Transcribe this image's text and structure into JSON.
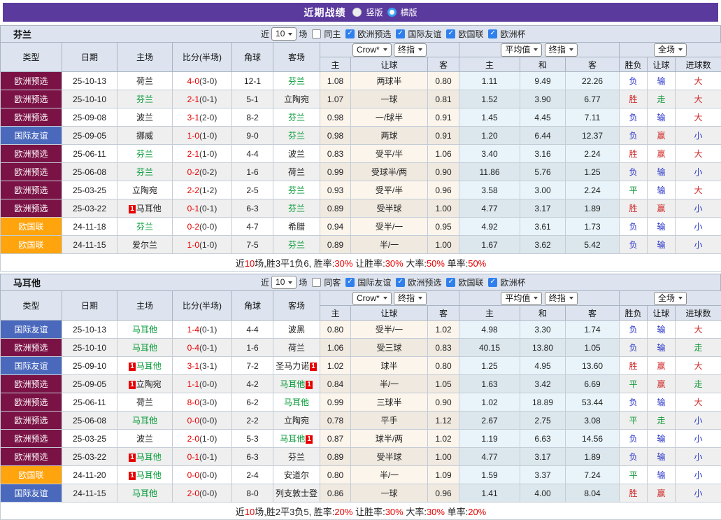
{
  "title_bar": {
    "title": "近期战绩",
    "vertical": "竖版",
    "horizontal": "横版"
  },
  "columns": [
    "类型",
    "日期",
    "主场",
    "比分(半场)",
    "角球",
    "客场"
  ],
  "sub_columns": [
    "主",
    "让球",
    "客",
    "主",
    "和",
    "客",
    "胜负",
    "让球",
    "进球数"
  ],
  "category_colors": {
    "欧洲预选": "#7a1245",
    "国际友谊": "#4a69bd",
    "欧国联": "#ffa40d",
    "欧洲杯": "#2e8b57"
  },
  "result_colors": {
    "r": "#cf2a2a",
    "g": "#189a3e",
    "b": "#2a35c8"
  },
  "tables": [
    {
      "team": "芬兰",
      "filters": {
        "near": "近",
        "count": "10",
        "games": "场",
        "same": "同主",
        "leagues": [
          "欧洲预选",
          "国际友谊",
          "欧国联",
          "欧洲杯"
        ]
      },
      "controls": {
        "company": "Crow*",
        "final1": "终指",
        "average": "平均值",
        "final2": "终指",
        "scope": "全场"
      },
      "rows": [
        {
          "type": "欧洲预选",
          "date": "25-10-13",
          "home": "荷兰",
          "home_self": false,
          "home_card": "",
          "score_full": "4-0",
          "score_half": "(3-0)",
          "corner": "12-1",
          "away": "芬兰",
          "away_self": true,
          "away_card": "",
          "crow_home": "1.08",
          "crow_hcp": "两球半",
          "crow_away": "0.80",
          "avg_home": "1.11",
          "avg_draw": "9.49",
          "avg_away": "22.26",
          "res_wdl": "负",
          "res_hcp": "输",
          "res_goal": "大"
        },
        {
          "type": "欧洲预选",
          "date": "25-10-10",
          "home": "芬兰",
          "home_self": true,
          "home_card": "",
          "score_full": "2-1",
          "score_half": "(0-1)",
          "corner": "5-1",
          "away": "立陶宛",
          "away_self": false,
          "away_card": "",
          "crow_home": "1.07",
          "crow_hcp": "一球",
          "crow_away": "0.81",
          "avg_home": "1.52",
          "avg_draw": "3.90",
          "avg_away": "6.77",
          "res_wdl": "胜",
          "res_hcp": "走",
          "res_goal": "大"
        },
        {
          "type": "欧洲预选",
          "date": "25-09-08",
          "home": "波兰",
          "home_self": false,
          "home_card": "",
          "score_full": "3-1",
          "score_half": "(2-0)",
          "corner": "8-2",
          "away": "芬兰",
          "away_self": true,
          "away_card": "",
          "crow_home": "0.98",
          "crow_hcp": "一/球半",
          "crow_away": "0.91",
          "avg_home": "1.45",
          "avg_draw": "4.45",
          "avg_away": "7.11",
          "res_wdl": "负",
          "res_hcp": "输",
          "res_goal": "大"
        },
        {
          "type": "国际友谊",
          "date": "25-09-05",
          "home": "挪威",
          "home_self": false,
          "home_card": "",
          "score_full": "1-0",
          "score_half": "(1-0)",
          "corner": "9-0",
          "away": "芬兰",
          "away_self": true,
          "away_card": "",
          "crow_home": "0.98",
          "crow_hcp": "两球",
          "crow_away": "0.91",
          "avg_home": "1.20",
          "avg_draw": "6.44",
          "avg_away": "12.37",
          "res_wdl": "负",
          "res_hcp": "赢",
          "res_goal": "小"
        },
        {
          "type": "欧洲预选",
          "date": "25-06-11",
          "home": "芬兰",
          "home_self": true,
          "home_card": "",
          "score_full": "2-1",
          "score_half": "(1-0)",
          "corner": "4-4",
          "away": "波兰",
          "away_self": false,
          "away_card": "",
          "crow_home": "0.83",
          "crow_hcp": "受平/半",
          "crow_away": "1.06",
          "avg_home": "3.40",
          "avg_draw": "3.16",
          "avg_away": "2.24",
          "res_wdl": "胜",
          "res_hcp": "赢",
          "res_goal": "大"
        },
        {
          "type": "欧洲预选",
          "date": "25-06-08",
          "home": "芬兰",
          "home_self": true,
          "home_card": "",
          "score_full": "0-2",
          "score_half": "(0-2)",
          "corner": "1-6",
          "away": "荷兰",
          "away_self": false,
          "away_card": "",
          "crow_home": "0.99",
          "crow_hcp": "受球半/两",
          "crow_away": "0.90",
          "avg_home": "11.86",
          "avg_draw": "5.76",
          "avg_away": "1.25",
          "res_wdl": "负",
          "res_hcp": "输",
          "res_goal": "小"
        },
        {
          "type": "欧洲预选",
          "date": "25-03-25",
          "home": "立陶宛",
          "home_self": false,
          "home_card": "",
          "score_full": "2-2",
          "score_half": "(1-2)",
          "corner": "2-5",
          "away": "芬兰",
          "away_self": true,
          "away_card": "",
          "crow_home": "0.93",
          "crow_hcp": "受平/半",
          "crow_away": "0.96",
          "avg_home": "3.58",
          "avg_draw": "3.00",
          "avg_away": "2.24",
          "res_wdl": "平",
          "res_hcp": "输",
          "res_goal": "大"
        },
        {
          "type": "欧洲预选",
          "date": "25-03-22",
          "home": "马耳他",
          "home_self": false,
          "home_card": "1",
          "score_full": "0-1",
          "score_half": "(0-1)",
          "corner": "6-3",
          "away": "芬兰",
          "away_self": true,
          "away_card": "",
          "crow_home": "0.89",
          "crow_hcp": "受半球",
          "crow_away": "1.00",
          "avg_home": "4.77",
          "avg_draw": "3.17",
          "avg_away": "1.89",
          "res_wdl": "胜",
          "res_hcp": "赢",
          "res_goal": "小"
        },
        {
          "type": "欧国联",
          "date": "24-11-18",
          "home": "芬兰",
          "home_self": true,
          "home_card": "",
          "score_full": "0-2",
          "score_half": "(0-0)",
          "corner": "4-7",
          "away": "希腊",
          "away_self": false,
          "away_card": "",
          "crow_home": "0.94",
          "crow_hcp": "受半/一",
          "crow_away": "0.95",
          "avg_home": "4.92",
          "avg_draw": "3.61",
          "avg_away": "1.73",
          "res_wdl": "负",
          "res_hcp": "输",
          "res_goal": "小"
        },
        {
          "type": "欧国联",
          "date": "24-11-15",
          "home": "爱尔兰",
          "home_self": false,
          "home_card": "",
          "score_full": "1-0",
          "score_half": "(1-0)",
          "corner": "7-5",
          "away": "芬兰",
          "away_self": true,
          "away_card": "",
          "crow_home": "0.89",
          "crow_hcp": "半/一",
          "crow_away": "1.00",
          "avg_home": "1.67",
          "avg_draw": "3.62",
          "avg_away": "5.42",
          "res_wdl": "负",
          "res_hcp": "输",
          "res_goal": "小"
        }
      ],
      "summary": [
        {
          "t": "近",
          "red": false
        },
        {
          "t": "10",
          "red": true
        },
        {
          "t": "场,胜3平1负6, 胜率:",
          "red": false
        },
        {
          "t": "30%",
          "red": true
        },
        {
          "t": " 让胜率:",
          "red": false
        },
        {
          "t": "30%",
          "red": true
        },
        {
          "t": " 大率:",
          "red": false
        },
        {
          "t": "50%",
          "red": true
        },
        {
          "t": " 单率:",
          "red": false
        },
        {
          "t": "50%",
          "red": true
        }
      ]
    },
    {
      "team": "马耳他",
      "filters": {
        "near": "近",
        "count": "10",
        "games": "场",
        "same": "同客",
        "leagues": [
          "国际友谊",
          "欧洲预选",
          "欧国联",
          "欧洲杯"
        ]
      },
      "controls": {
        "company": "Crow*",
        "final1": "终指",
        "average": "平均值",
        "final2": "终指",
        "scope": "全场"
      },
      "rows": [
        {
          "type": "国际友谊",
          "date": "25-10-13",
          "home": "马耳他",
          "home_self": true,
          "home_card": "",
          "score_full": "1-4",
          "score_half": "(0-1)",
          "corner": "4-4",
          "away": "波黑",
          "away_self": false,
          "away_card": "",
          "crow_home": "0.80",
          "crow_hcp": "受半/一",
          "crow_away": "1.02",
          "avg_home": "4.98",
          "avg_draw": "3.30",
          "avg_away": "1.74",
          "res_wdl": "负",
          "res_hcp": "输",
          "res_goal": "大"
        },
        {
          "type": "欧洲预选",
          "date": "25-10-10",
          "home": "马耳他",
          "home_self": true,
          "home_card": "",
          "score_full": "0-4",
          "score_half": "(0-1)",
          "corner": "1-6",
          "away": "荷兰",
          "away_self": false,
          "away_card": "",
          "crow_home": "1.06",
          "crow_hcp": "受三球",
          "crow_away": "0.83",
          "avg_home": "40.15",
          "avg_draw": "13.80",
          "avg_away": "1.05",
          "res_wdl": "负",
          "res_hcp": "输",
          "res_goal": "走"
        },
        {
          "type": "国际友谊",
          "date": "25-09-10",
          "home": "马耳他",
          "home_self": true,
          "home_card": "1",
          "score_full": "3-1",
          "score_half": "(3-1)",
          "corner": "7-2",
          "away": "圣马力诺",
          "away_self": false,
          "away_card": "1",
          "crow_home": "1.02",
          "crow_hcp": "球半",
          "crow_away": "0.80",
          "avg_home": "1.25",
          "avg_draw": "4.95",
          "avg_away": "13.60",
          "res_wdl": "胜",
          "res_hcp": "赢",
          "res_goal": "大"
        },
        {
          "type": "欧洲预选",
          "date": "25-09-05",
          "home": "立陶宛",
          "home_self": false,
          "home_card": "1",
          "score_full": "1-1",
          "score_half": "(0-0)",
          "corner": "4-2",
          "away": "马耳他",
          "away_self": true,
          "away_card": "1",
          "crow_home": "0.84",
          "crow_hcp": "半/一",
          "crow_away": "1.05",
          "avg_home": "1.63",
          "avg_draw": "3.42",
          "avg_away": "6.69",
          "res_wdl": "平",
          "res_hcp": "赢",
          "res_goal": "走"
        },
        {
          "type": "欧洲预选",
          "date": "25-06-11",
          "home": "荷兰",
          "home_self": false,
          "home_card": "",
          "score_full": "8-0",
          "score_half": "(3-0)",
          "corner": "6-2",
          "away": "马耳他",
          "away_self": true,
          "away_card": "",
          "crow_home": "0.99",
          "crow_hcp": "三球半",
          "crow_away": "0.90",
          "avg_home": "1.02",
          "avg_draw": "18.89",
          "avg_away": "53.44",
          "res_wdl": "负",
          "res_hcp": "输",
          "res_goal": "大"
        },
        {
          "type": "欧洲预选",
          "date": "25-06-08",
          "home": "马耳他",
          "home_self": true,
          "home_card": "",
          "score_full": "0-0",
          "score_half": "(0-0)",
          "corner": "2-2",
          "away": "立陶宛",
          "away_self": false,
          "away_card": "",
          "crow_home": "0.78",
          "crow_hcp": "平手",
          "crow_away": "1.12",
          "avg_home": "2.67",
          "avg_draw": "2.75",
          "avg_away": "3.08",
          "res_wdl": "平",
          "res_hcp": "走",
          "res_goal": "小"
        },
        {
          "type": "欧洲预选",
          "date": "25-03-25",
          "home": "波兰",
          "home_self": false,
          "home_card": "",
          "score_full": "2-0",
          "score_half": "(1-0)",
          "corner": "5-3",
          "away": "马耳他",
          "away_self": true,
          "away_card": "1",
          "crow_home": "0.87",
          "crow_hcp": "球半/两",
          "crow_away": "1.02",
          "avg_home": "1.19",
          "avg_draw": "6.63",
          "avg_away": "14.56",
          "res_wdl": "负",
          "res_hcp": "输",
          "res_goal": "小"
        },
        {
          "type": "欧洲预选",
          "date": "25-03-22",
          "home": "马耳他",
          "home_self": true,
          "home_card": "1",
          "score_full": "0-1",
          "score_half": "(0-1)",
          "corner": "6-3",
          "away": "芬兰",
          "away_self": false,
          "away_card": "",
          "crow_home": "0.89",
          "crow_hcp": "受半球",
          "crow_away": "1.00",
          "avg_home": "4.77",
          "avg_draw": "3.17",
          "avg_away": "1.89",
          "res_wdl": "负",
          "res_hcp": "输",
          "res_goal": "小"
        },
        {
          "type": "欧国联",
          "date": "24-11-20",
          "home": "马耳他",
          "home_self": true,
          "home_card": "1",
          "score_full": "0-0",
          "score_half": "(0-0)",
          "corner": "2-4",
          "away": "安道尔",
          "away_self": false,
          "away_card": "",
          "crow_home": "0.80",
          "crow_hcp": "半/一",
          "crow_away": "1.09",
          "avg_home": "1.59",
          "avg_draw": "3.37",
          "avg_away": "7.24",
          "res_wdl": "平",
          "res_hcp": "输",
          "res_goal": "小"
        },
        {
          "type": "国际友谊",
          "date": "24-11-15",
          "home": "马耳他",
          "home_self": true,
          "home_card": "",
          "score_full": "2-0",
          "score_half": "(0-0)",
          "corner": "8-0",
          "away": "列支敦士登",
          "away_self": false,
          "away_card": "",
          "crow_home": "0.86",
          "crow_hcp": "一球",
          "crow_away": "0.96",
          "avg_home": "1.41",
          "avg_draw": "4.00",
          "avg_away": "8.04",
          "res_wdl": "胜",
          "res_hcp": "赢",
          "res_goal": "小"
        }
      ],
      "summary": [
        {
          "t": "近",
          "red": false
        },
        {
          "t": "10",
          "red": true
        },
        {
          "t": "场,胜2平3负5, 胜率:",
          "red": false
        },
        {
          "t": "20%",
          "red": true
        },
        {
          "t": " 让胜率:",
          "red": false
        },
        {
          "t": "30%",
          "red": true
        },
        {
          "t": " 大率:",
          "red": false
        },
        {
          "t": "30%",
          "red": true
        },
        {
          "t": " 单率:",
          "red": false
        },
        {
          "t": "20%",
          "red": true
        }
      ]
    }
  ]
}
